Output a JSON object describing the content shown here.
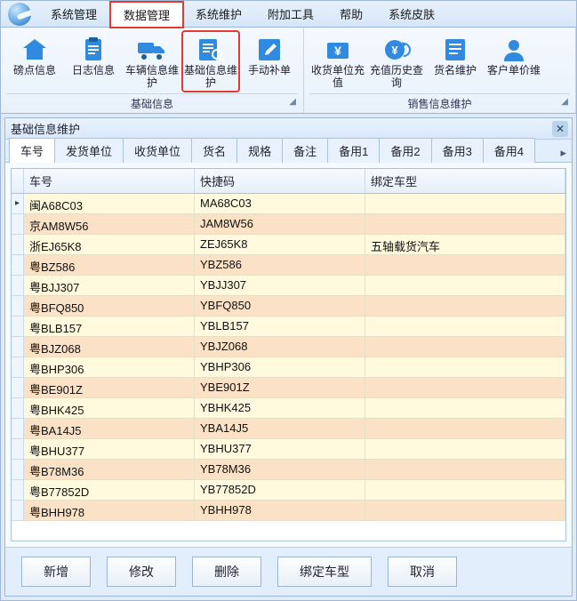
{
  "menu": {
    "items": [
      "系统管理",
      "数据管理",
      "系统维护",
      "附加工具",
      "帮助",
      "系统皮肤"
    ],
    "active_index": 1
  },
  "ribbon": {
    "group1": {
      "label": "基础信息",
      "buttons": [
        {
          "label": "磅点信息",
          "icon": "home"
        },
        {
          "label": "日志信息",
          "icon": "clipboard"
        },
        {
          "label": "车辆信息维护",
          "icon": "truck"
        },
        {
          "label": "基础信息维护",
          "icon": "search-doc"
        },
        {
          "label": "手动补单",
          "icon": "edit"
        }
      ],
      "highlighted_index": 3
    },
    "group2": {
      "label": "销售信息维护",
      "buttons": [
        {
          "label": "收货单位充值",
          "icon": "money"
        },
        {
          "label": "充值历史查询",
          "icon": "money-refresh"
        },
        {
          "label": "货名维护",
          "icon": "list"
        },
        {
          "label": "客户单价维",
          "icon": "person"
        }
      ]
    }
  },
  "panel": {
    "title": "基础信息维护",
    "tabs": [
      "车号",
      "发货单位",
      "收货单位",
      "货名",
      "规格",
      "备注",
      "备用1",
      "备用2",
      "备用3",
      "备用4"
    ],
    "active_tab": 0
  },
  "grid": {
    "columns": [
      "车号",
      "快捷码",
      "绑定车型"
    ],
    "rows": [
      {
        "c0": "闽A68C03",
        "c1": "MA68C03",
        "c2": ""
      },
      {
        "c0": "京AM8W56",
        "c1": "JAM8W56",
        "c2": ""
      },
      {
        "c0": "浙EJ65K8",
        "c1": "ZEJ65K8",
        "c2": "五轴载货汽车"
      },
      {
        "c0": "粤BZ586",
        "c1": "YBZ586",
        "c2": ""
      },
      {
        "c0": "粤BJJ307",
        "c1": "YBJJ307",
        "c2": ""
      },
      {
        "c0": "粤BFQ850",
        "c1": "YBFQ850",
        "c2": ""
      },
      {
        "c0": "粤BLB157",
        "c1": "YBLB157",
        "c2": ""
      },
      {
        "c0": "粤BJZ068",
        "c1": "YBJZ068",
        "c2": ""
      },
      {
        "c0": "粤BHP306",
        "c1": "YBHP306",
        "c2": ""
      },
      {
        "c0": "粤BE901Z",
        "c1": "YBE901Z",
        "c2": ""
      },
      {
        "c0": "粤BHK425",
        "c1": "YBHK425",
        "c2": ""
      },
      {
        "c0": "粤BA14J5",
        "c1": "YBA14J5",
        "c2": ""
      },
      {
        "c0": "粤BHU377",
        "c1": "YBHU377",
        "c2": ""
      },
      {
        "c0": "粤B78M36",
        "c1": "YB78M36",
        "c2": ""
      },
      {
        "c0": "粤B77852D",
        "c1": "YB77852D",
        "c2": ""
      },
      {
        "c0": "粤BHH978",
        "c1": "YBHH978",
        "c2": ""
      }
    ]
  },
  "buttons": {
    "add": "新增",
    "edit": "修改",
    "delete": "删除",
    "bind": "绑定车型",
    "cancel": "取消"
  }
}
